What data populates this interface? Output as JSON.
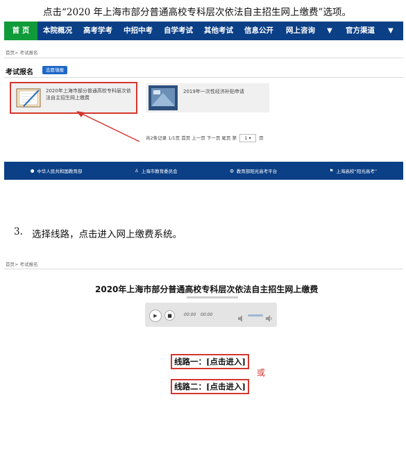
{
  "instructions": {
    "step2": "点击“2020 年上海市部分普通高校专科层次依法自主招生网上缴费”选项。",
    "step3_number": "3.",
    "step3_text": "选择线路，点击进入网上缴费系统。"
  },
  "screenshot1": {
    "nav": [
      "首 页",
      "本院概况",
      "高考学考",
      "中招中考",
      "自学考试",
      "其他考试",
      "信息公开",
      "网上咨询",
      "官方渠道"
    ],
    "breadcrumb": "首页> 考试报名",
    "section_title": "考试报名",
    "tag": "志愿填报",
    "cards": [
      {
        "title": "2020年上海市部分普通高校专科层次依法自主招生网上缴费"
      },
      {
        "title": "2019年一次性经济补贴申请"
      }
    ],
    "pager": {
      "text": "共2条记录 1/1页 首页 上一页 下一页 尾页 第",
      "page": "1",
      "suffix": "页"
    },
    "footer": [
      "中华人民共和国教育部",
      "上海市教育委员会",
      "教育部阳光高考平台",
      "上海高校“阳光高考”"
    ]
  },
  "screenshot2": {
    "breadcrumb": "首页> 考试报名",
    "title": "2020年上海市部分普通高校专科层次依法自主招生网上缴费",
    "player": {
      "current": "00:00",
      "total": "00:00"
    },
    "route1": "线路一：[点击进入]",
    "route2": "线路二：[点击进入]",
    "or": "或"
  },
  "colors": {
    "nav_blue": "#0b3f86",
    "nav_active_green": "#109b3a",
    "highlight_red": "#d3352c"
  }
}
